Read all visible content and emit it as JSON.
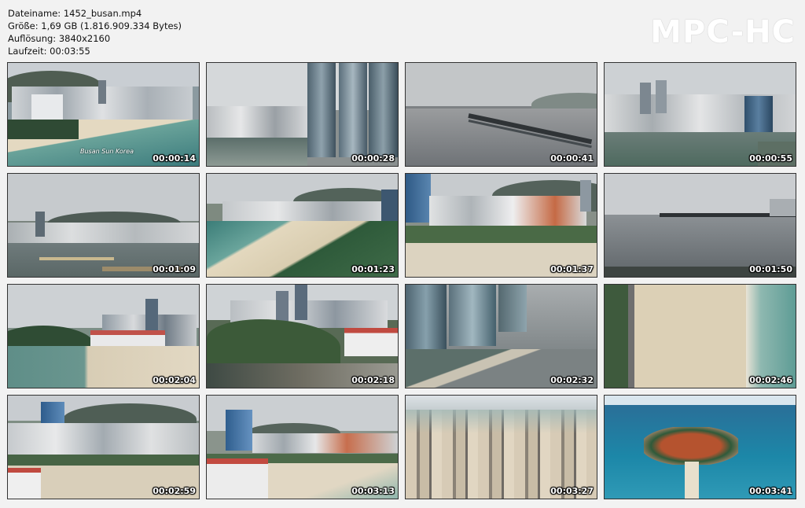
{
  "info": {
    "filename_line": "Dateiname: 1452_busan.mp4",
    "size_line": "Größe: 1,69 GB (1.816.909.334 Bytes)",
    "resolution_line": "Auflösung: 3840x2160",
    "duration_line": "Laufzeit: 00:03:55"
  },
  "brand": "MPC-HC",
  "thumbnails": [
    {
      "time": "00:00:14"
    },
    {
      "time": "00:00:28"
    },
    {
      "time": "00:00:41"
    },
    {
      "time": "00:00:55"
    },
    {
      "time": "00:01:09"
    },
    {
      "time": "00:01:23"
    },
    {
      "time": "00:01:37"
    },
    {
      "time": "00:01:50"
    },
    {
      "time": "00:02:04"
    },
    {
      "time": "00:02:18"
    },
    {
      "time": "00:02:32"
    },
    {
      "time": "00:02:46"
    },
    {
      "time": "00:02:59"
    },
    {
      "time": "00:03:13"
    },
    {
      "time": "00:03:27"
    },
    {
      "time": "00:03:41"
    }
  ],
  "caption": "Busan Sun Korea",
  "colors": {
    "background": "#f2f2f2",
    "brand_text": "#ffffff",
    "timestamp_text": "#ffffff"
  }
}
